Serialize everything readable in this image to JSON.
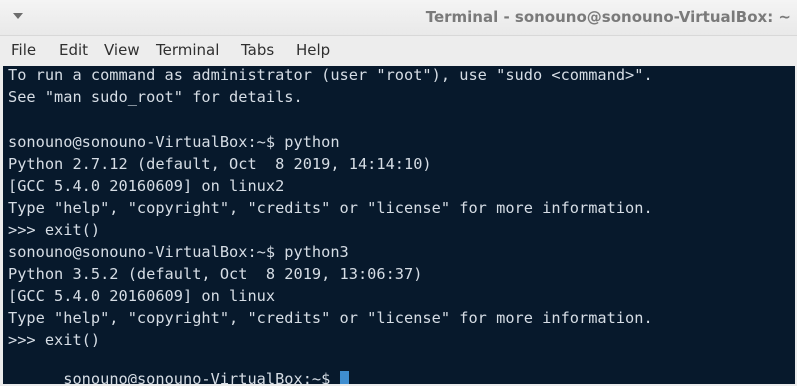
{
  "window": {
    "title": "Terminal - sonouno@sonouno-VirtualBox: ~"
  },
  "menu": {
    "items": [
      "File",
      "Edit",
      "View",
      "Terminal",
      "Tabs",
      "Help"
    ]
  },
  "terminal": {
    "lines": [
      "To run a command as administrator (user \"root\"), use \"sudo <command>\".",
      "See \"man sudo_root\" for details.",
      "",
      "sonouno@sonouno-VirtualBox:~$ python",
      "Python 2.7.12 (default, Oct  8 2019, 14:14:10)",
      "[GCC 5.4.0 20160609] on linux2",
      "Type \"help\", \"copyright\", \"credits\" or \"license\" for more information.",
      ">>> exit()",
      "sonouno@sonouno-VirtualBox:~$ python3",
      "Python 3.5.2 (default, Oct  8 2019, 13:06:37)",
      "[GCC 5.4.0 20160609] on linux",
      "Type \"help\", \"copyright\", \"credits\" or \"license\" for more information.",
      ">>> exit()",
      "sonouno@sonouno-VirtualBox:~$ "
    ]
  },
  "icons": {
    "title_menu": "chevron-down-icon"
  },
  "colors": {
    "terminal_background": "#07192c",
    "terminal_text": "#d6dde5",
    "cursor": "#3f8ed0"
  }
}
